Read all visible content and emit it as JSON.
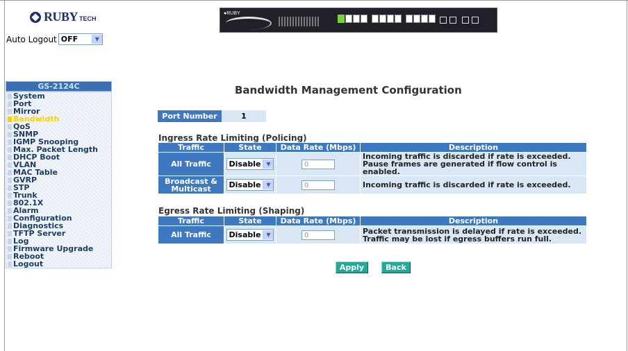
{
  "brand": {
    "logo_text": "RUBY",
    "logo_sub": "TECH"
  },
  "auto_logout": {
    "label": "Auto Logout",
    "value": "OFF"
  },
  "sidebar": {
    "title": "GS-2124C",
    "items": [
      {
        "label": "System",
        "active": false
      },
      {
        "label": "Port",
        "active": false
      },
      {
        "label": "Mirror",
        "active": false
      },
      {
        "label": "Bandwidth",
        "active": true
      },
      {
        "label": "QoS",
        "active": false
      },
      {
        "label": "SNMP",
        "active": false
      },
      {
        "label": "IGMP Snooping",
        "active": false
      },
      {
        "label": "Max. Packet Length",
        "active": false
      },
      {
        "label": "DHCP Boot",
        "active": false
      },
      {
        "label": "VLAN",
        "active": false
      },
      {
        "label": "MAC Table",
        "active": false
      },
      {
        "label": "GVRP",
        "active": false
      },
      {
        "label": "STP",
        "active": false
      },
      {
        "label": "Trunk",
        "active": false
      },
      {
        "label": "802.1X",
        "active": false
      },
      {
        "label": "Alarm",
        "active": false
      },
      {
        "label": "Configuration",
        "active": false
      },
      {
        "label": "Diagnostics",
        "active": false
      },
      {
        "label": "TFTP Server",
        "active": false
      },
      {
        "label": "Log",
        "active": false
      },
      {
        "label": "Firmware Upgrade",
        "active": false
      },
      {
        "label": "Reboot",
        "active": false
      },
      {
        "label": "Logout",
        "active": false
      }
    ]
  },
  "main": {
    "title": "Bandwidth Management Configuration",
    "port_number": {
      "label": "Port Number",
      "value": "1"
    },
    "ingress": {
      "title": "Ingress Rate Limiting (Policing)",
      "headers": [
        "Traffic",
        "State",
        "Data Rate (Mbps)",
        "Description"
      ],
      "rows": [
        {
          "traffic": "All Traffic",
          "state": "Disable",
          "rate": "0",
          "desc_1": "Incoming traffic is discarded if rate is exceeded.",
          "desc_2": "Pause frames are generated if flow control is enabled."
        },
        {
          "traffic_1": "Broadcast &",
          "traffic_2": "Multicast",
          "state": "Disable",
          "rate": "0",
          "desc_1": "Incoming traffic is discarded if rate is exceeded."
        }
      ]
    },
    "egress": {
      "title": "Egress Rate Limiting (Shaping)",
      "headers": [
        "Traffic",
        "State",
        "Data Rate (Mbps)",
        "Description"
      ],
      "rows": [
        {
          "traffic": "All Traffic",
          "state": "Disable",
          "rate": "0",
          "desc_1": "Packet transmission is delayed if rate is exceeded.",
          "desc_2": "Traffic may be lost if egress buffers run full."
        }
      ]
    },
    "buttons": {
      "apply": "Apply",
      "back": "Back"
    }
  }
}
